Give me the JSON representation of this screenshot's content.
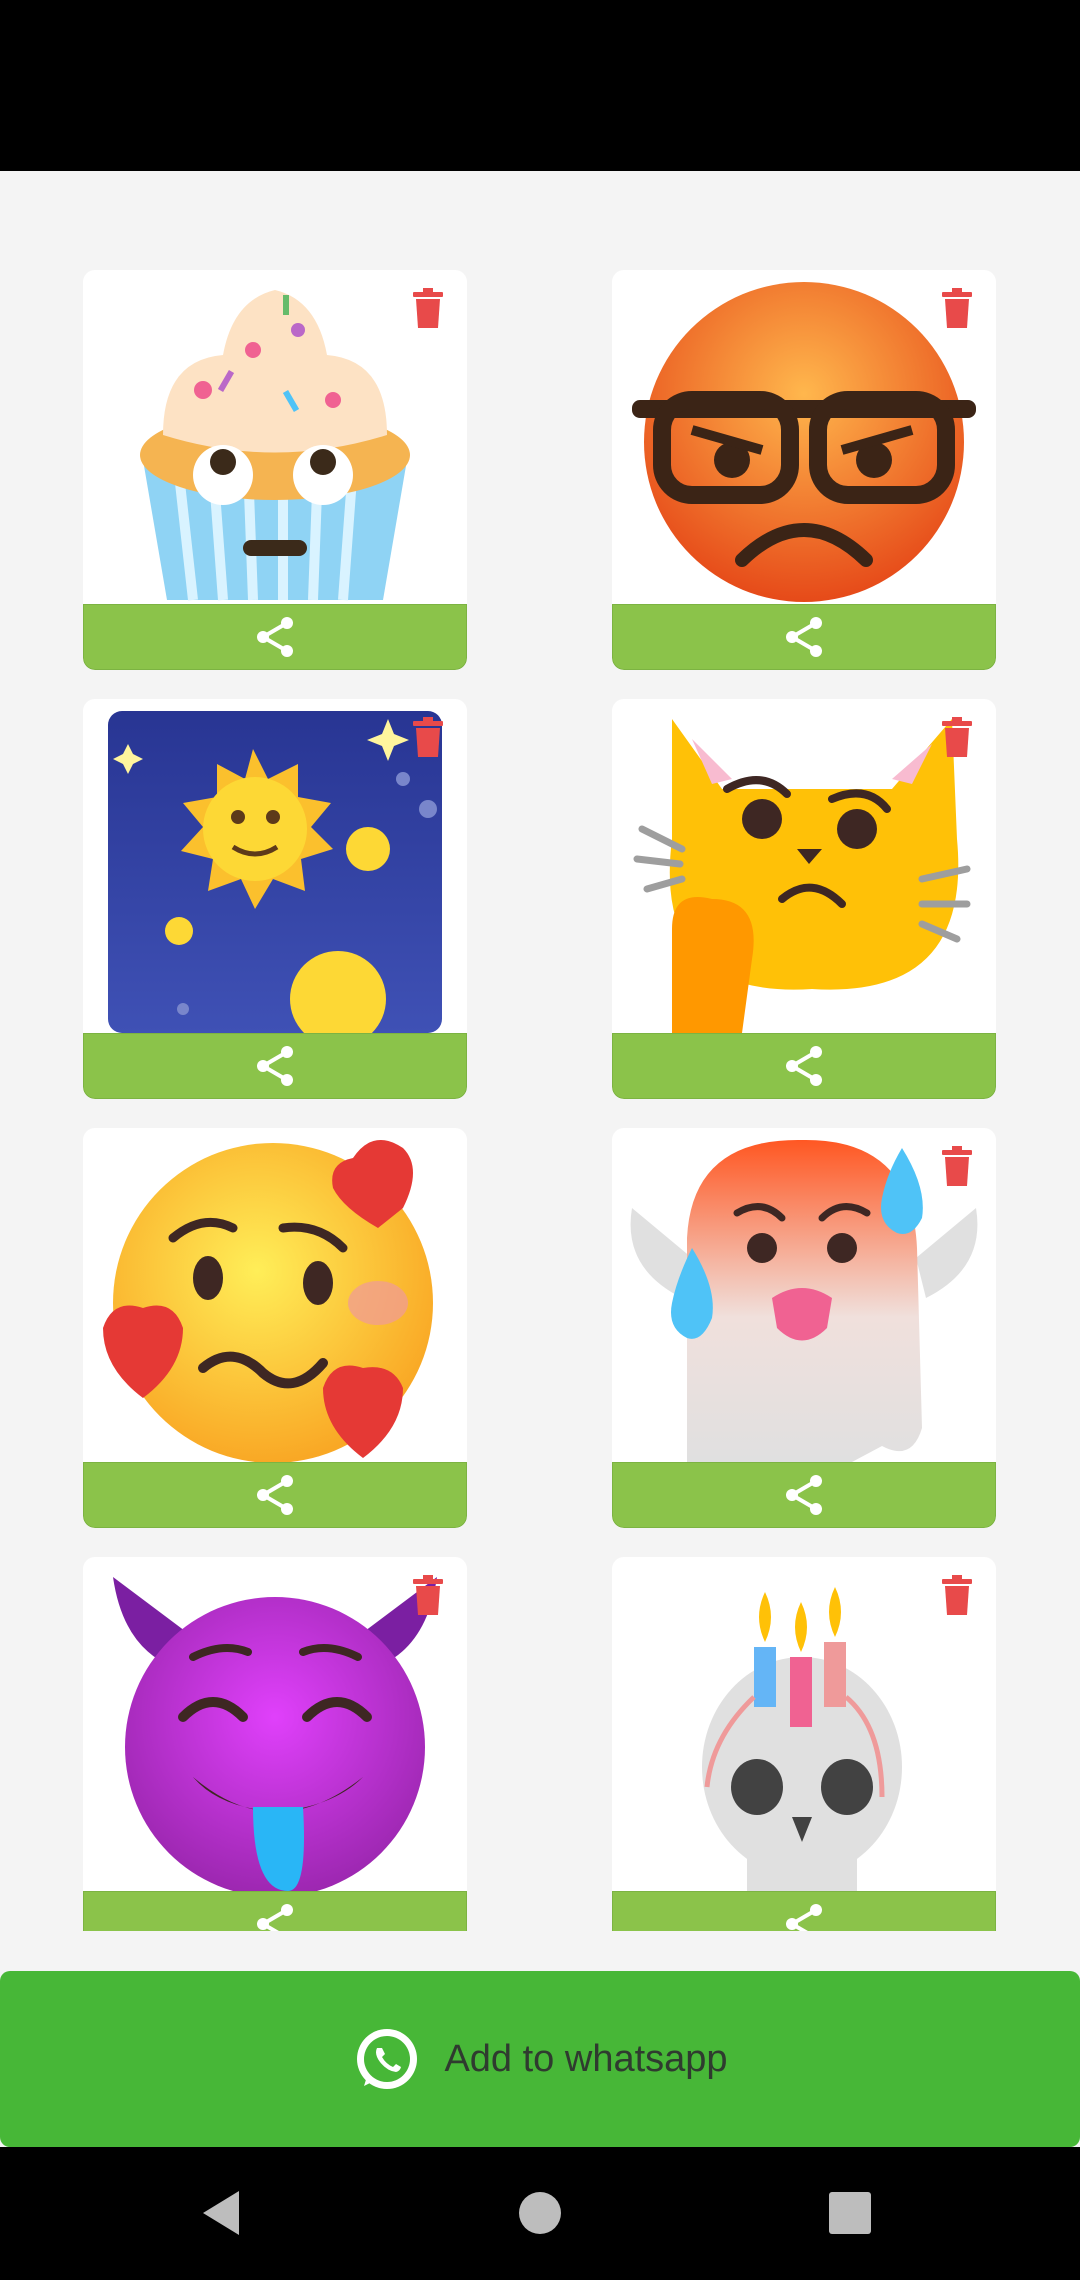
{
  "stickers": [
    {
      "name": "cupcake-emoji",
      "share_icon": "share-icon",
      "delete_icon": "trash-icon"
    },
    {
      "name": "angry-nerd-emoji",
      "share_icon": "share-icon",
      "delete_icon": "trash-icon"
    },
    {
      "name": "sun-night-thinking-emoji",
      "share_icon": "share-icon",
      "delete_icon": "trash-icon"
    },
    {
      "name": "thinking-cat-emoji",
      "share_icon": "share-icon",
      "delete_icon": "trash-icon"
    },
    {
      "name": "woozy-broken-heart-emoji",
      "share_icon": "share-icon",
      "delete_icon": "trash-icon"
    },
    {
      "name": "hot-ghost-emoji",
      "share_icon": "share-icon",
      "delete_icon": "trash-icon"
    },
    {
      "name": "drooling-devil-emoji",
      "share_icon": "share-icon",
      "delete_icon": "trash-icon"
    },
    {
      "name": "candle-skull-emoji",
      "share_icon": "share-icon",
      "delete_icon": "trash-icon"
    }
  ],
  "add_button": {
    "label": "Add to whatsapp",
    "icon": "whatsapp-icon"
  },
  "nav": {
    "back": "back-icon",
    "home": "home-icon",
    "recents": "recents-icon"
  },
  "colors": {
    "share_bar": "#8bc34a",
    "add_button": "#47b737",
    "trash": "#e84a4a"
  }
}
